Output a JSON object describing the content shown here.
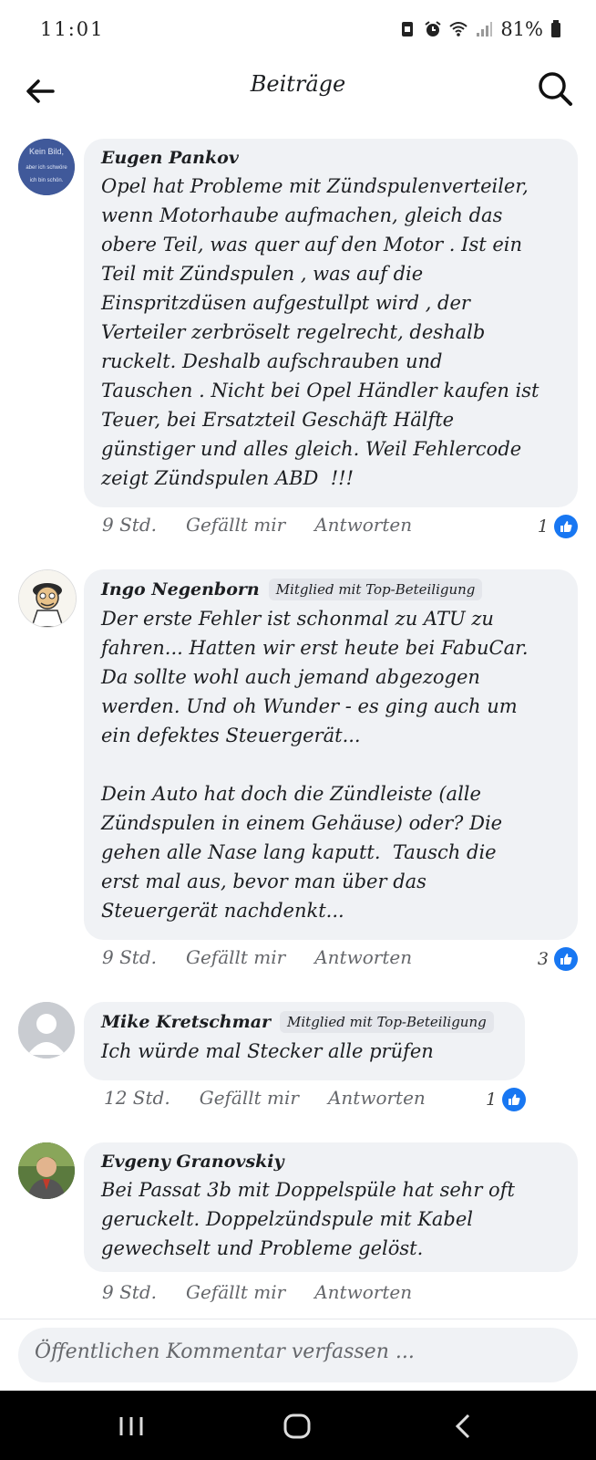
{
  "status": {
    "time": "11:01",
    "battery": "81%"
  },
  "header": {
    "title": "Beiträge"
  },
  "comments": [
    {
      "author": "Eugen Pankov",
      "badge": "",
      "avatar_text": [
        "Kein Bild,",
        "aber ich schwöre",
        "ich bin schön."
      ],
      "text": "Opel hat Probleme mit Zündspulenverteiler,\nwenn Motorhaube aufmachen, gleich das\nobere Teil, was quer auf den Motor . Ist ein\nTeil mit Zündspulen , was auf die\nEinspritzdüsen aufgestullpt wird , der\nVerteiler zerbröselt regelrecht, deshalb\nruckelt. Deshalb aufschrauben und\nTauschen . Nicht bei Opel Händler kaufen ist\nTeuer, bei Ersatzteil Geschäft Hälfte\ngünstiger und alles gleich. Weil Fehlercode\nzeigt Zündspulen ABD  !!!",
      "time": "9 Std.",
      "like_label": "Gefällt mir",
      "reply_label": "Antworten",
      "reactions": "1"
    },
    {
      "author": "Ingo Negenborn",
      "badge": "Mitglied mit Top-Beteiligung",
      "text": "Der erste Fehler ist schonmal zu ATU zu\nfahren... Hatten wir erst heute bei FabuCar.\nDa sollte wohl auch jemand abgezogen\nwerden. Und oh Wunder - es ging auch um\nein defektes Steuergerät...\n\nDein Auto hat doch die Zündleiste (alle\nZündspulen in einem Gehäuse) oder? Die\ngehen alle Nase lang kaputt.  Tausch die\nerst mal aus, bevor man über das\nSteuergerät nachdenkt...",
      "time": "9 Std.",
      "like_label": "Gefällt mir",
      "reply_label": "Antworten",
      "reactions": "3"
    },
    {
      "author": "Mike Kretschmar",
      "badge": "Mitglied mit Top-Beteiligung",
      "text": "Ich würde mal Stecker alle prüfen",
      "time": "12 Std.",
      "like_label": "Gefällt mir",
      "reply_label": "Antworten",
      "reactions": "1"
    },
    {
      "author": "Evgeny Granovskiy",
      "badge": "",
      "text": "Bei Passat 3b mit Doppelspüle hat sehr oft\ngeruckelt. Doppelzündspule mit Kabel\ngewechselt und Probleme gelöst.",
      "time": "9 Std.",
      "like_label": "Gefällt mir",
      "reply_label": "Antworten",
      "reactions": ""
    }
  ],
  "composer": {
    "placeholder": "Öffentlichen Kommentar verfassen ..."
  },
  "colors": {
    "like_blue": "#1877f2",
    "bubble_bg": "#f0f2f5",
    "meta_gray": "#65676b"
  }
}
